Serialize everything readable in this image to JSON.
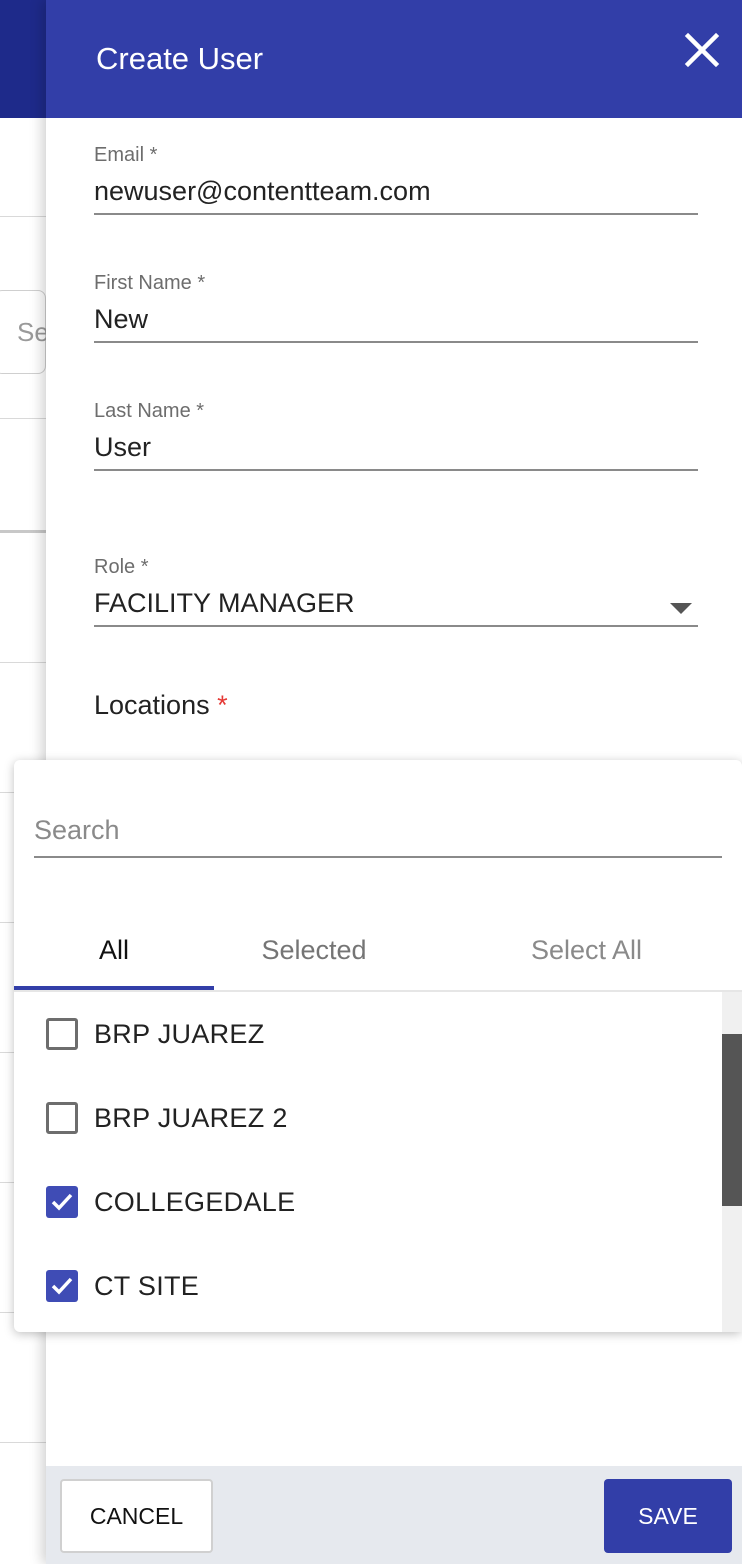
{
  "background_page": {
    "search_placeholder": "Se"
  },
  "dialog": {
    "title": "Create User",
    "close_icon": "close-icon"
  },
  "form": {
    "email": {
      "label": "Email *",
      "value": "newuser@contentteam.com"
    },
    "first_name": {
      "label": "First Name *",
      "value": "New"
    },
    "last_name": {
      "label": "Last Name *",
      "value": "User"
    },
    "role": {
      "label": "Role *",
      "value": "FACILITY MANAGER",
      "icon": "chevron-down-icon"
    },
    "locations": {
      "label": "Locations",
      "required_mark": "*"
    }
  },
  "locations_picker": {
    "search_placeholder": "Search",
    "tabs": [
      {
        "label": "All",
        "active": true
      },
      {
        "label": "Selected",
        "active": false
      },
      {
        "label": "Select All",
        "active": false
      }
    ],
    "items": [
      {
        "name": "BRP JUAREZ",
        "checked": false
      },
      {
        "name": "BRP JUAREZ 2",
        "checked": false
      },
      {
        "name": "COLLEGEDALE",
        "checked": true
      },
      {
        "name": "CT SITE",
        "checked": true
      }
    ]
  },
  "footer": {
    "cancel_label": "CANCEL",
    "save_label": "SAVE"
  },
  "colors": {
    "primary": "#323ea8",
    "required": "#e53935",
    "checkbox_on": "#3f4cb5"
  }
}
